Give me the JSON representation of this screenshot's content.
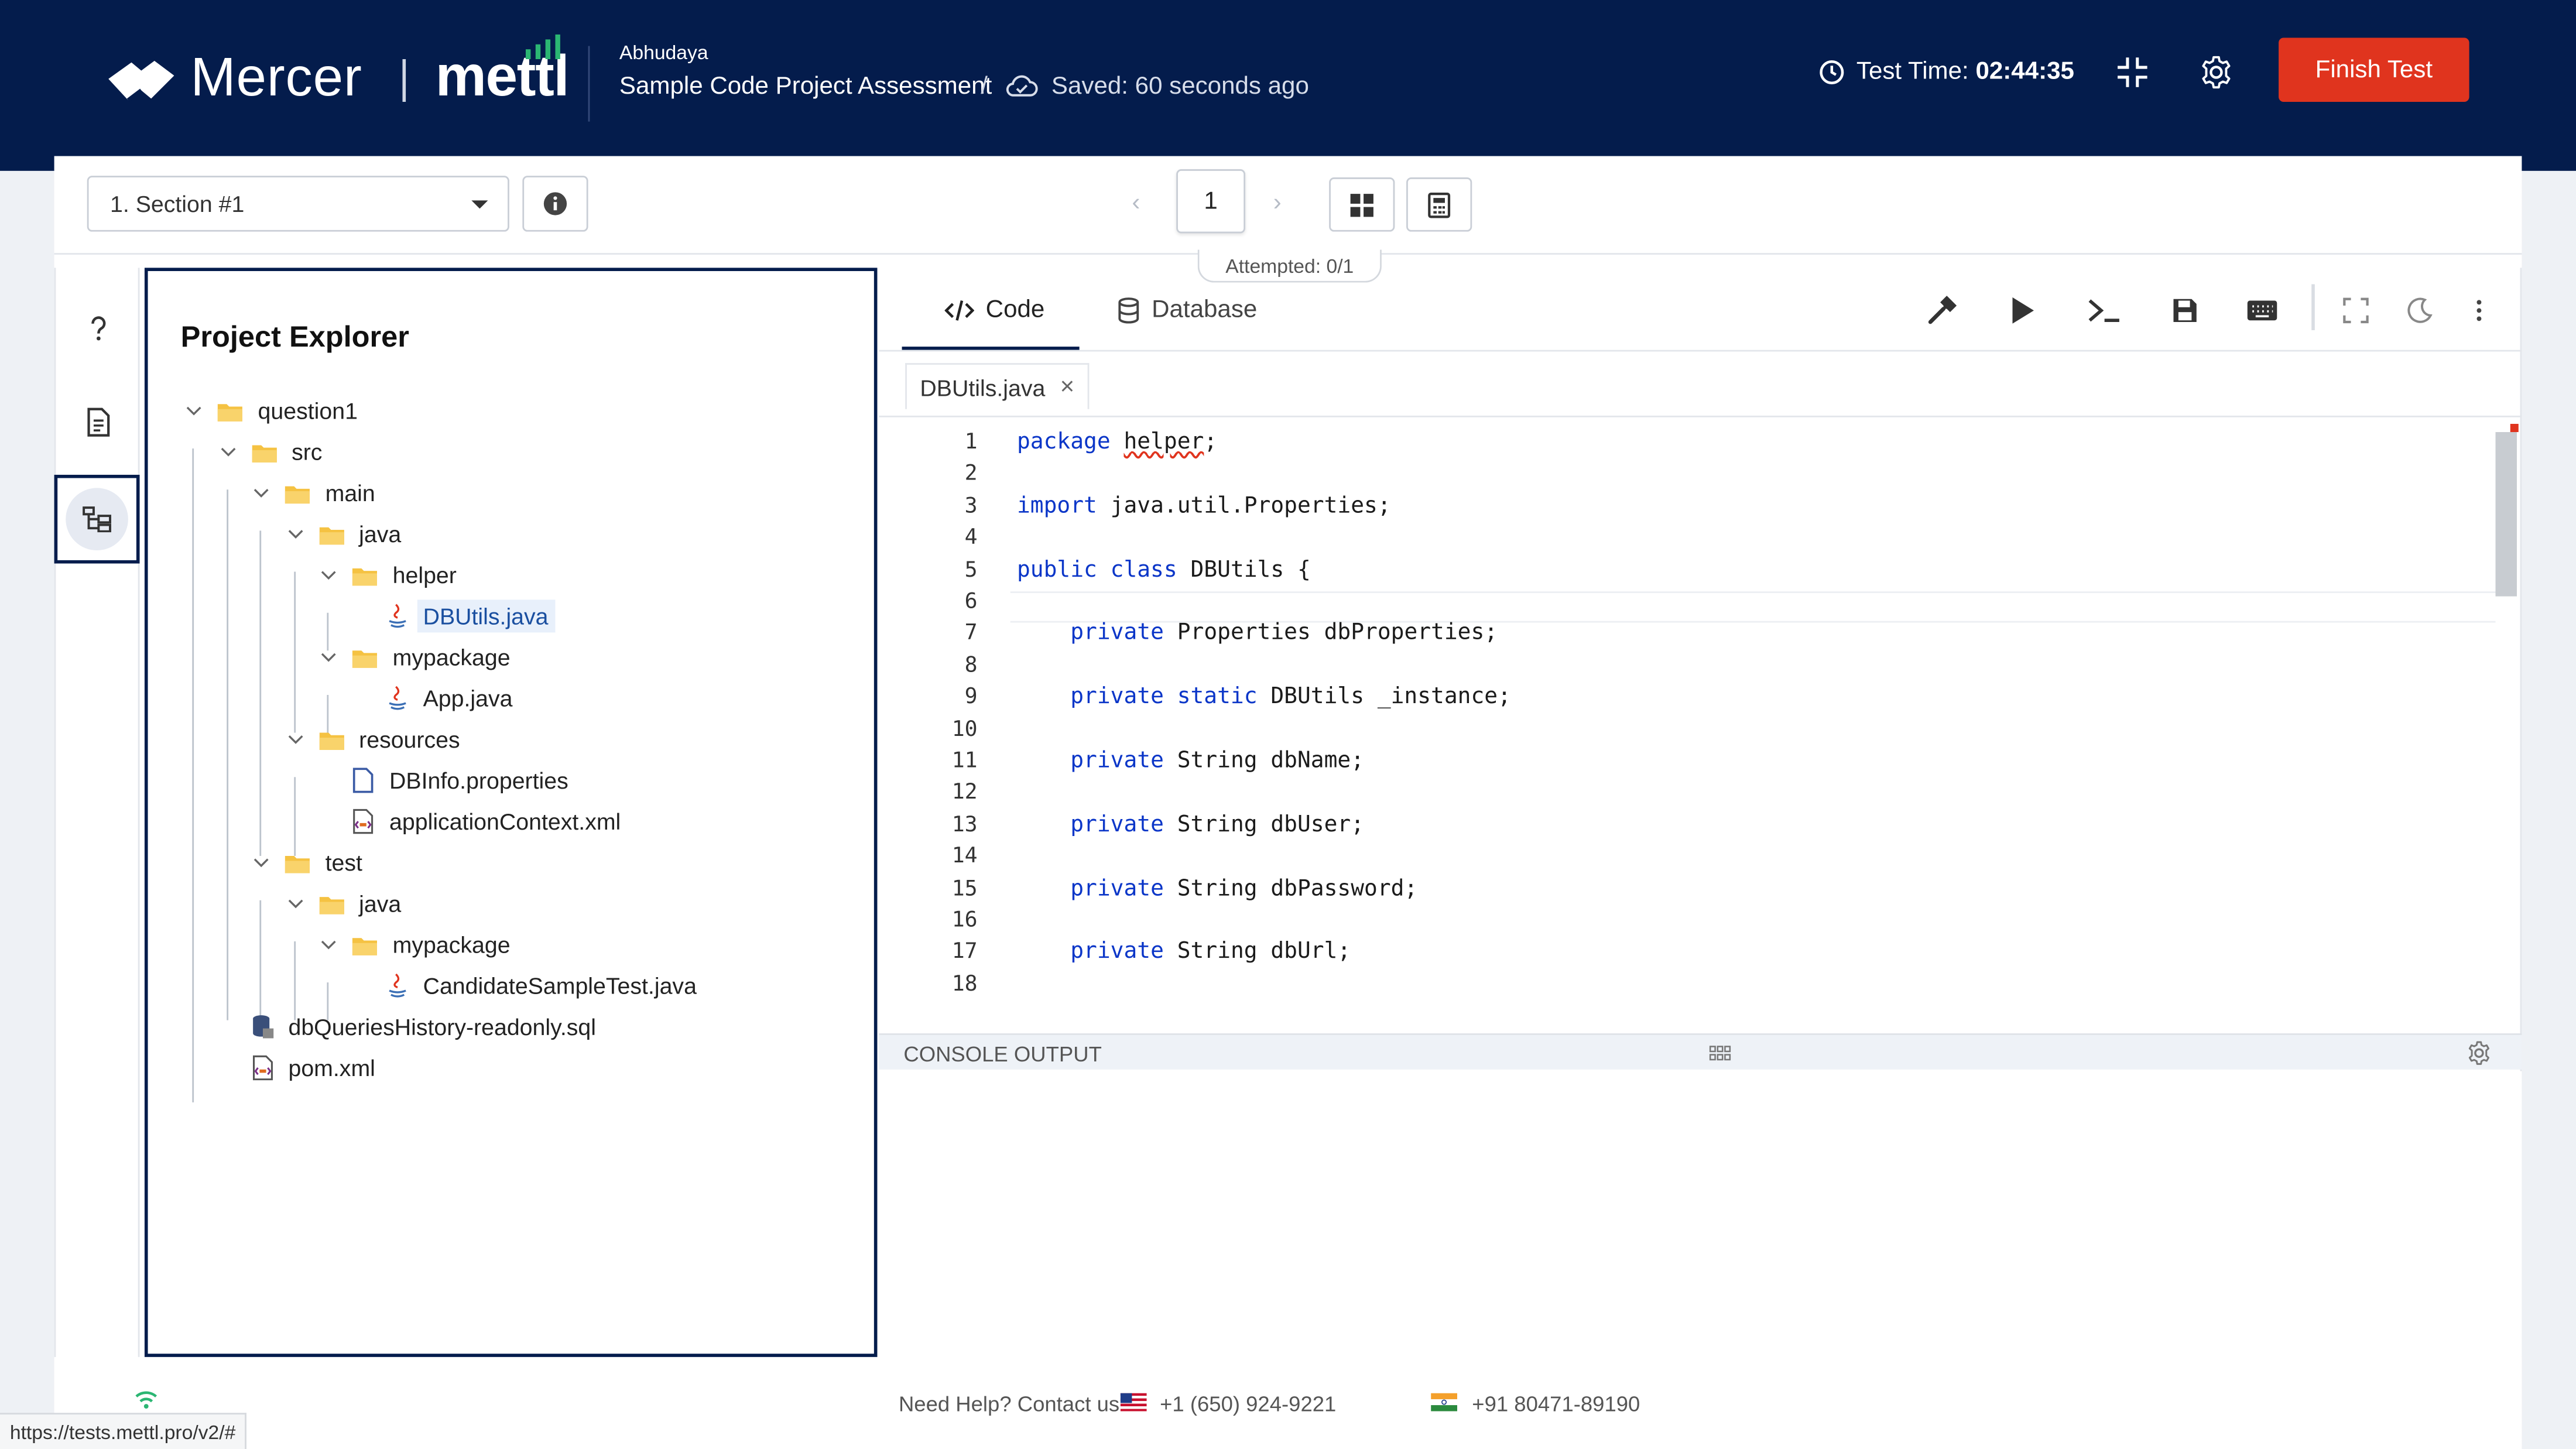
{
  "header": {
    "brand": "Mercer",
    "brand2": "mettl",
    "candidate_name": "Abhudaya",
    "assessment_name": "Sample Code Project Assessment",
    "separator": "/",
    "save_status": "Saved: 60 seconds ago",
    "test_time_label": "Test Time:",
    "test_time_value": "02:44:35",
    "finish_label": "Finish Test",
    "colors": {
      "header_bg": "#041c4c",
      "finish_bg": "#e0341e"
    }
  },
  "toolbar": {
    "section_selected": "1. Section #1",
    "current_page": "1",
    "prev_glyph": "‹",
    "next_glyph": "›",
    "attempted": "Attempted: 0/1"
  },
  "rail": {
    "items": [
      {
        "icon": "question-icon",
        "active": false
      },
      {
        "icon": "document-icon",
        "active": false
      },
      {
        "icon": "tree-icon",
        "active": true
      }
    ]
  },
  "explorer": {
    "title": "Project Explorer",
    "items": [
      {
        "label": "question1",
        "type": "folder",
        "depth": 0,
        "bold": true
      },
      {
        "label": "src",
        "type": "folder",
        "depth": 1,
        "bold": true
      },
      {
        "label": "main",
        "type": "folder",
        "depth": 2,
        "bold": true
      },
      {
        "label": "java",
        "type": "folder",
        "depth": 3,
        "bold": true
      },
      {
        "label": "helper",
        "type": "folder",
        "depth": 4,
        "bold": true
      },
      {
        "label": "DBUtils.java",
        "type": "java",
        "depth": 5,
        "selected": true
      },
      {
        "label": "mypackage",
        "type": "folder",
        "depth": 4,
        "bold": true
      },
      {
        "label": "App.java",
        "type": "java",
        "depth": 5
      },
      {
        "label": "resources",
        "type": "folder",
        "depth": 3,
        "bold": true
      },
      {
        "label": "DBInfo.properties",
        "type": "props",
        "depth": 4
      },
      {
        "label": "applicationContext.xml",
        "type": "xml",
        "depth": 4
      },
      {
        "label": "test",
        "type": "folder",
        "depth": 2,
        "bold": true
      },
      {
        "label": "java",
        "type": "folder",
        "depth": 3,
        "bold": true
      },
      {
        "label": "mypackage",
        "type": "folder",
        "depth": 4,
        "bold": true
      },
      {
        "label": "CandidateSampleTest.java",
        "type": "java",
        "depth": 5
      },
      {
        "label": "dbQueriesHistory-readonly.sql",
        "type": "sql",
        "depth": 1
      },
      {
        "label": "pom.xml",
        "type": "xml",
        "depth": 1
      }
    ]
  },
  "editor": {
    "tabs": [
      {
        "label": "Code",
        "active": true
      },
      {
        "label": "Database",
        "active": false
      }
    ],
    "open_file": "DBUtils.java",
    "close_glyph": "×",
    "code_lines": [
      [
        {
          "t": "package ",
          "k": true
        },
        {
          "t": "helper",
          "sq": true
        },
        {
          "t": ";"
        }
      ],
      [],
      [
        {
          "t": "import ",
          "k": true
        },
        {
          "t": "java.util.Properties;"
        }
      ],
      [],
      [
        {
          "t": "public class ",
          "k": true
        },
        {
          "t": "DBUtils {"
        }
      ],
      [],
      [
        {
          "t": "    "
        },
        {
          "t": "private ",
          "k": true
        },
        {
          "t": "Properties dbProperties;"
        }
      ],
      [],
      [
        {
          "t": "    "
        },
        {
          "t": "private static ",
          "k": true
        },
        {
          "t": "DBUtils _instance;"
        }
      ],
      [],
      [
        {
          "t": "    "
        },
        {
          "t": "private ",
          "k": true
        },
        {
          "t": "String dbName;"
        }
      ],
      [],
      [
        {
          "t": "    "
        },
        {
          "t": "private ",
          "k": true
        },
        {
          "t": "String dbUser;"
        }
      ],
      [],
      [
        {
          "t": "    "
        },
        {
          "t": "private ",
          "k": true
        },
        {
          "t": "String dbPassword;"
        }
      ],
      [],
      [
        {
          "t": "    "
        },
        {
          "t": "private ",
          "k": true
        },
        {
          "t": "String dbUrl;"
        }
      ],
      []
    ],
    "console_label": "CONSOLE OUTPUT"
  },
  "footer": {
    "help_label": "Need Help? Contact us:",
    "phone_us": "+1 (650) 924-9221",
    "phone_in": "+91 80471-89190",
    "status_url": "https://tests.mettl.pro/v2/#"
  }
}
